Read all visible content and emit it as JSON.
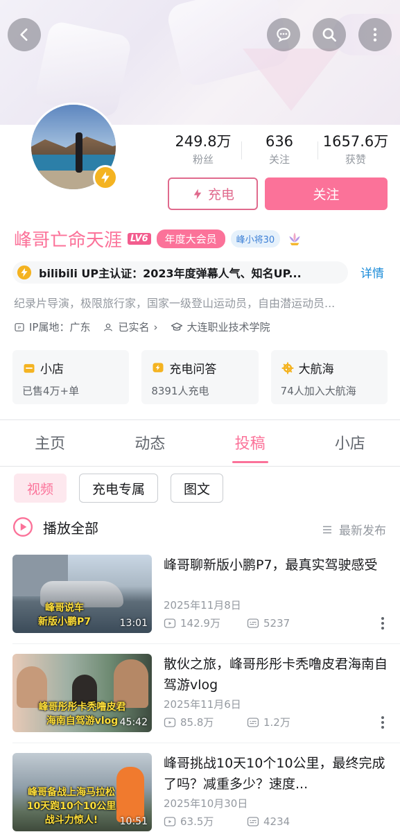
{
  "header": {
    "back_icon": "back-arrow-icon",
    "message_icon": "chat-bubble-icon",
    "search_icon": "search-icon",
    "more_icon": "more-vertical-icon"
  },
  "profile": {
    "name": "峰哥亡命天涯",
    "level": "LV6",
    "vip_badge": "年度大会员",
    "fan_medal": "峰小将30",
    "stats": [
      {
        "value": "249.8万",
        "label": "粉丝"
      },
      {
        "value": "636",
        "label": "关注"
      },
      {
        "value": "1657.6万",
        "label": "获赞"
      }
    ],
    "charge_button": "充电",
    "follow_button": "关注",
    "verification": "bilibili UP主认证：2023年度弹幕人气、知名UP...",
    "detail_link": "详情",
    "bio": "纪录片导演，极限旅行家，国家一级登山运动员，自由潜运动员...",
    "ip_location": "IP属地：广东",
    "real_name": "已实名",
    "school": "大连职业技术学院"
  },
  "cards": [
    {
      "title": "小店",
      "sub": "已售4万+单"
    },
    {
      "title": "充电问答",
      "sub": "8391人充电"
    },
    {
      "title": "大航海",
      "sub": "74人加入大航海"
    }
  ],
  "tabs": [
    "主页",
    "动态",
    "投稿",
    "小店"
  ],
  "active_tab": "投稿",
  "chips": [
    "视频",
    "充电专属",
    "图文"
  ],
  "play_all": "播放全部",
  "sort_label": "最新发布",
  "videos": [
    {
      "title": "峰哥聊新版小鹏P7，最真实驾驶感受",
      "date": "2025年11月8日",
      "views": "142.9万",
      "danmaku": "5237",
      "duration": "13:01",
      "thumb_caption": "峰哥说车\n新版小鹏P7"
    },
    {
      "title": "散伙之旅，峰哥彤彤卡秃噜皮君海南自驾游vlog",
      "date": "2025年11月6日",
      "views": "85.8万",
      "danmaku": "1.2万",
      "duration": "45:42",
      "thumb_caption": "峰哥彤彤卡秃噜皮君\n海南自驾游vlog"
    },
    {
      "title": "峰哥挑战10天10个10公里，最终完成了吗？减重多少？速度...",
      "date": "2025年10月30日",
      "views": "63.5万",
      "danmaku": "4234",
      "duration": "10:51",
      "thumb_caption": "峰哥备战上海马拉松\n10天跑10个10公里\n战斗力惊人!"
    }
  ],
  "colors": {
    "accent": "#fb7299",
    "link": "#1a8bd8",
    "muted": "#9499a0"
  }
}
